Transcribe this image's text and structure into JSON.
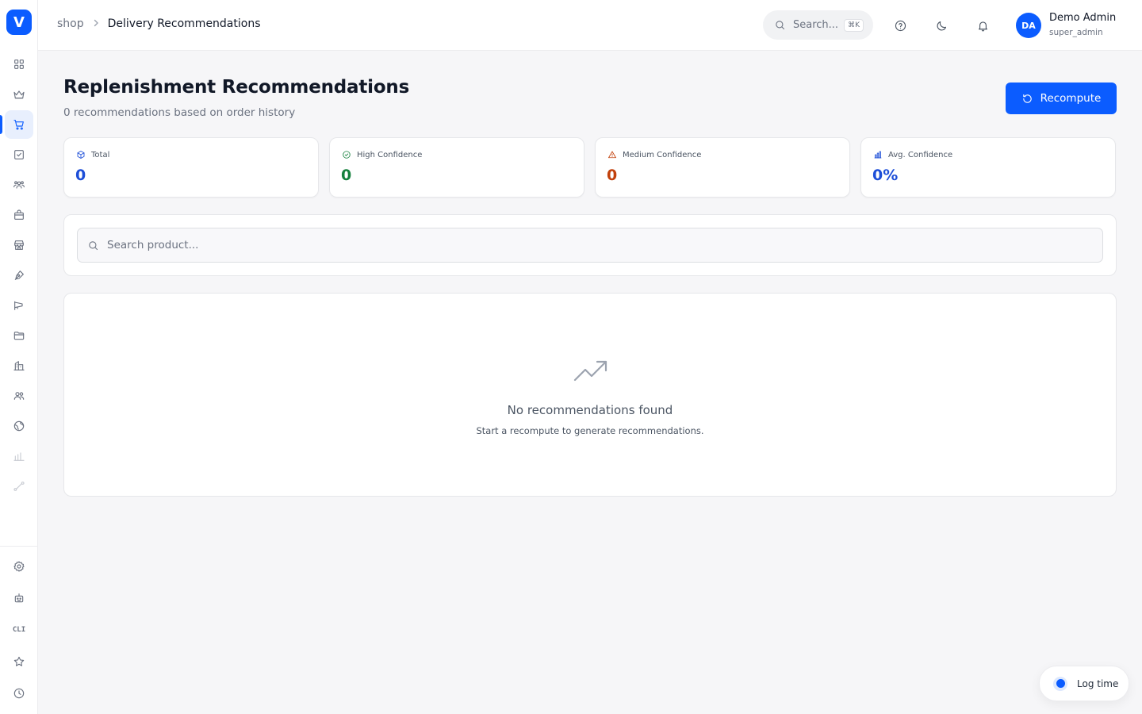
{
  "app": {
    "logo_letter": "V"
  },
  "breadcrumb": {
    "root": "shop",
    "separator": ">",
    "current": "Delivery Recommendations"
  },
  "topbar": {
    "search_placeholder": "Search...",
    "search_shortcut": "⌘K",
    "user": {
      "initials": "DA",
      "name": "Demo Admin",
      "role": "super_admin"
    }
  },
  "sidebar": {
    "items": [
      {
        "icon": "dashboard-icon"
      },
      {
        "icon": "crown-icon"
      },
      {
        "icon": "cart-icon",
        "active": true
      },
      {
        "icon": "checkbox-icon"
      },
      {
        "icon": "team-icon"
      },
      {
        "icon": "bag-icon"
      },
      {
        "icon": "store-icon"
      },
      {
        "icon": "pen-icon"
      },
      {
        "icon": "megaphone-icon"
      },
      {
        "icon": "folder-icon"
      },
      {
        "icon": "building-icon"
      },
      {
        "icon": "users-icon"
      },
      {
        "icon": "globe-icon"
      },
      {
        "icon": "bar-chart-icon",
        "dimmed": true
      },
      {
        "icon": "route-icon",
        "dimmed": true
      }
    ],
    "bottom_items": [
      {
        "icon": "gear-icon"
      },
      {
        "icon": "robot-icon"
      },
      {
        "icon": "cli-icon",
        "label": "CLI"
      },
      {
        "icon": "star-icon"
      },
      {
        "icon": "clock-icon"
      }
    ]
  },
  "page": {
    "title": "Replenishment Recommendations",
    "subtitle": "0 recommendations based on order history",
    "recompute_label": "Recompute"
  },
  "stats": [
    {
      "label": "Total",
      "value": "0",
      "icon": "box-icon",
      "color": "#1d4ed8"
    },
    {
      "label": "High Confidence",
      "value": "0",
      "icon": "check-circle-icon",
      "color": "#15803d"
    },
    {
      "label": "Medium Confidence",
      "value": "0",
      "icon": "warning-icon",
      "color": "#c2410c"
    },
    {
      "label": "Avg. Confidence",
      "value": "0%",
      "icon": "bar-chart-icon",
      "color": "#1d4ed8"
    }
  ],
  "search": {
    "placeholder": "Search product..."
  },
  "empty_state": {
    "icon": "trending-up-icon",
    "title": "No recommendations found",
    "subtitle": "Start a recompute to generate recommendations."
  },
  "log_time": {
    "label": "Log time"
  }
}
